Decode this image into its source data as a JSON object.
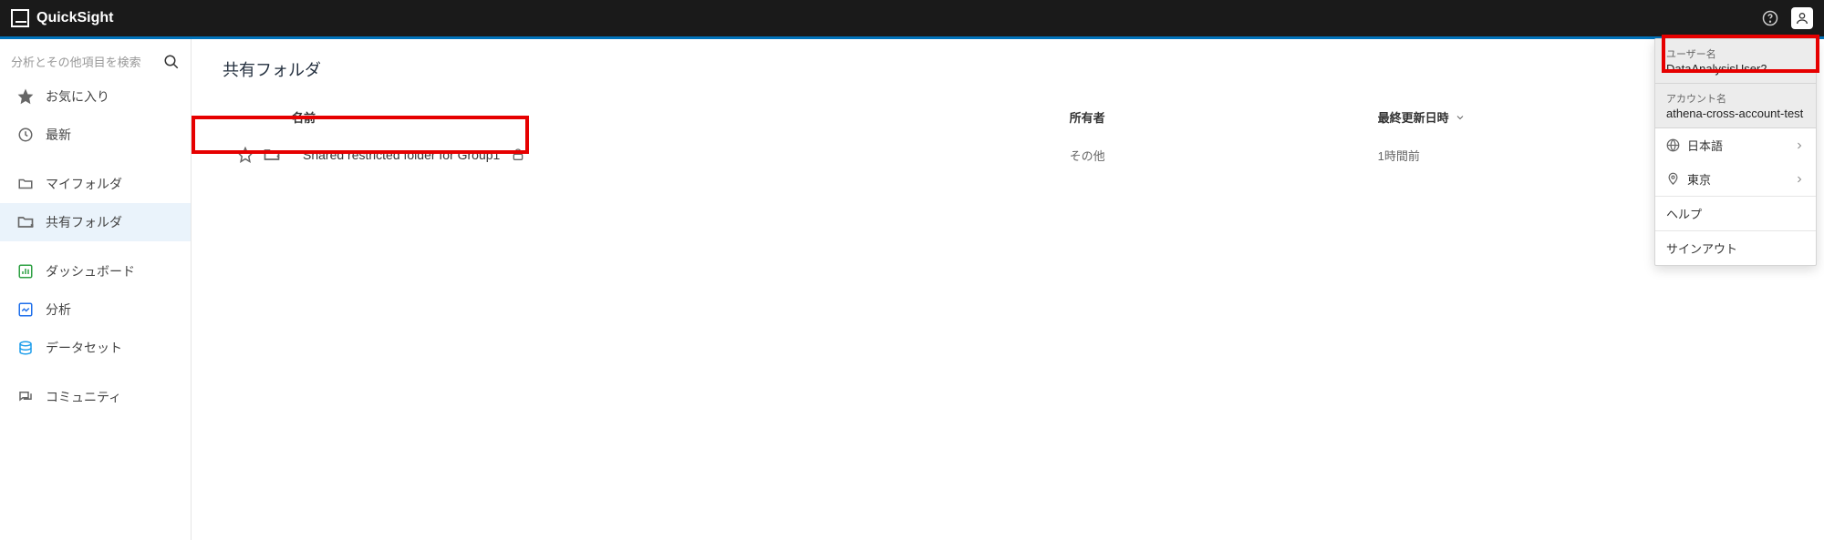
{
  "brand": "QuickSight",
  "search_placeholder": "分析とその他項目を検索",
  "sidebar": {
    "items": [
      {
        "label": "お気に入り"
      },
      {
        "label": "最新"
      },
      {
        "label": "マイフォルダ"
      },
      {
        "label": "共有フォルダ"
      },
      {
        "label": "ダッシュボード"
      },
      {
        "label": "分析"
      },
      {
        "label": "データセット"
      },
      {
        "label": "コミュニティ"
      }
    ]
  },
  "page_title": "共有フォルダ",
  "table": {
    "headers": {
      "name": "名前",
      "owner": "所有者",
      "modified": "最終更新日時"
    },
    "rows": [
      {
        "name": "Shared restricted folder for Group1",
        "owner": "その他",
        "modified": "1時間前"
      }
    ]
  },
  "user_menu": {
    "user_label": "ユーザー名",
    "user_value": "DataAnalysisUser2",
    "account_label": "アカウント名",
    "account_value": "athena-cross-account-test",
    "language": "日本語",
    "region": "東京",
    "help": "ヘルプ",
    "signout": "サインアウト"
  }
}
